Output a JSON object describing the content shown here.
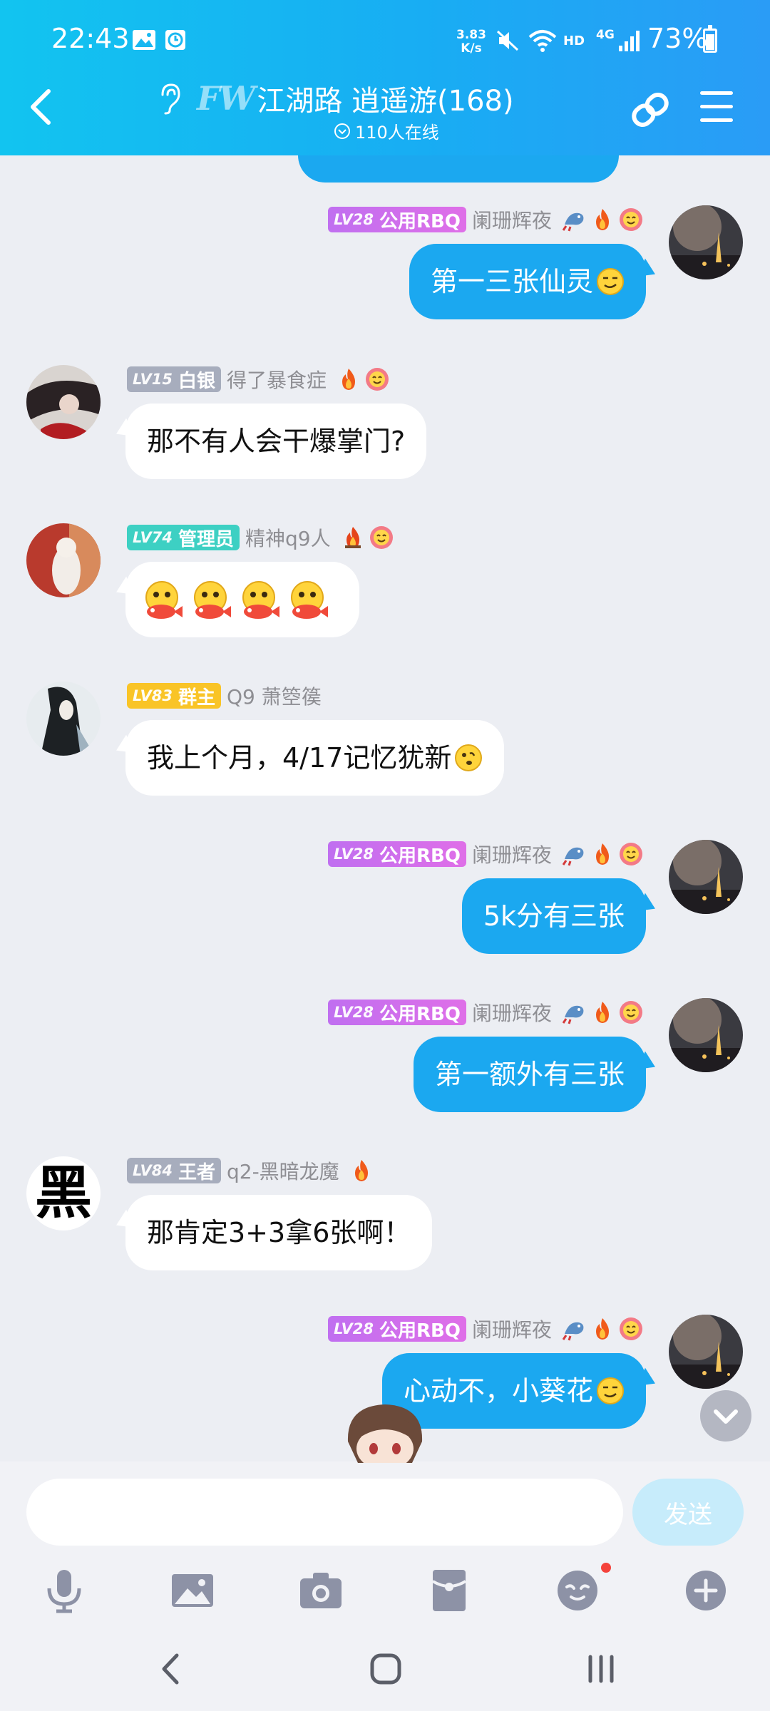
{
  "status_bar": {
    "time": "22:43",
    "net_speed_top": "3.83",
    "net_speed_bottom": "K/s",
    "hd": "HD",
    "network": "4G",
    "battery": "73%"
  },
  "header": {
    "logo_text": "FW",
    "title": "江湖路 逍遥游(168)",
    "online": "110人在线"
  },
  "colors": {
    "header_start": "#12c4f0",
    "header_end": "#2a9cf6",
    "outgoing_bubble": "#1ba8f0",
    "badge_purple": "#c06ff0",
    "badge_teal": "#3dd0c3",
    "badge_yellow": "#f9c427",
    "badge_gray": "#a7adbd"
  },
  "messages": [
    {
      "side": "right",
      "level": "LV28",
      "title": "公用RBQ",
      "nick": "阑珊辉夜",
      "text": "第一三张仙灵",
      "icons": [
        "dragon-icon",
        "fire-icon",
        "flower-face-icon"
      ],
      "trailing_emoji": "smirk-emoji"
    },
    {
      "side": "left",
      "level": "LV15",
      "title": "白银",
      "nick": "得了暴食症",
      "text": "那不有人会干爆掌门?",
      "icons": [
        "fire-icon",
        "flower-face-icon"
      ]
    },
    {
      "side": "left",
      "level": "LV74",
      "title": "管理员",
      "nick": "精神q9人",
      "text": "",
      "icons": [
        "fire-icon",
        "flower-face-icon"
      ],
      "emoji_count": 4,
      "emoji": "fish-face-emoji"
    },
    {
      "side": "left",
      "level": "LV83",
      "title": "群主",
      "nick": "Q9 萧箜篌",
      "text": "我上个月，4/17记忆犹新",
      "icons": [],
      "trailing_emoji": "dizzy-face-emoji"
    },
    {
      "side": "right",
      "level": "LV28",
      "title": "公用RBQ",
      "nick": "阑珊辉夜",
      "text": "5k分有三张",
      "icons": [
        "dragon-icon",
        "fire-icon",
        "flower-face-icon"
      ]
    },
    {
      "side": "right",
      "level": "LV28",
      "title": "公用RBQ",
      "nick": "阑珊辉夜",
      "text": "第一额外有三张",
      "icons": [
        "dragon-icon",
        "fire-icon",
        "flower-face-icon"
      ]
    },
    {
      "side": "left",
      "level": "LV84",
      "title": "王者",
      "nick": "q2-黑暗龙魔",
      "text": "那肯定3+3拿6张啊！",
      "icons": [
        "fire-icon"
      ],
      "avatar_text": "黑"
    },
    {
      "side": "right",
      "level": "LV28",
      "title": "公用RBQ",
      "nick": "阑珊辉夜",
      "text": "心动不，小葵花",
      "icons": [
        "dragon-icon",
        "fire-icon",
        "flower-face-icon"
      ],
      "trailing_emoji": "smirk-emoji"
    }
  ],
  "input": {
    "placeholder": "",
    "send_label": "发送"
  },
  "toolbar": [
    "microphone-icon",
    "image-icon",
    "camera-icon",
    "red-packet-icon",
    "emoji-icon",
    "plus-icon"
  ]
}
